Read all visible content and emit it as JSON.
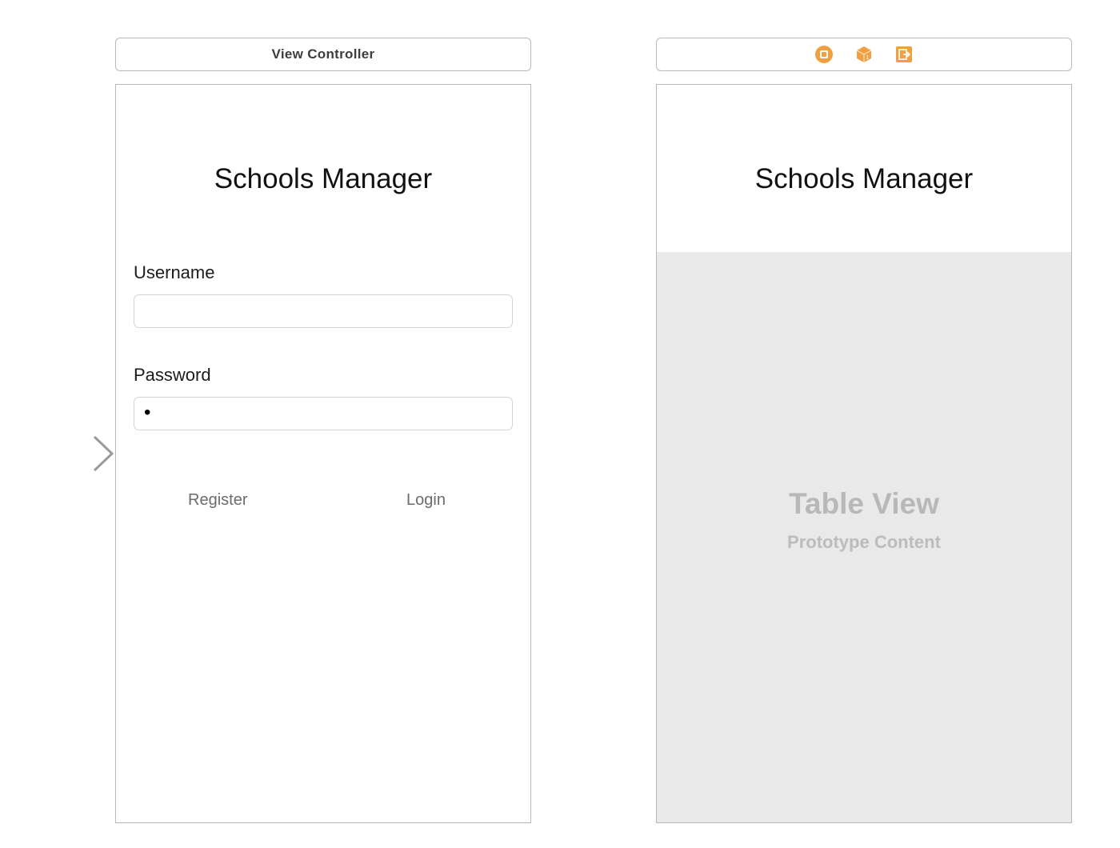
{
  "login_scene": {
    "scene_title": "View Controller",
    "app_title": "Schools Manager",
    "username": {
      "label": "Username",
      "value": ""
    },
    "password": {
      "label": "Password",
      "value": "•"
    },
    "register_label": "Register",
    "login_label": "Login"
  },
  "table_scene": {
    "toolbar_icons": [
      "view-controller-icon",
      "first-responder-icon",
      "exit-icon"
    ],
    "app_title": "Schools Manager",
    "table_title": "Table View",
    "table_subtitle": "Prototype Content"
  },
  "colors": {
    "accent_orange": "#f0a040",
    "table_background": "#e9e9e9",
    "arrow_gray": "#9a9a9a"
  }
}
